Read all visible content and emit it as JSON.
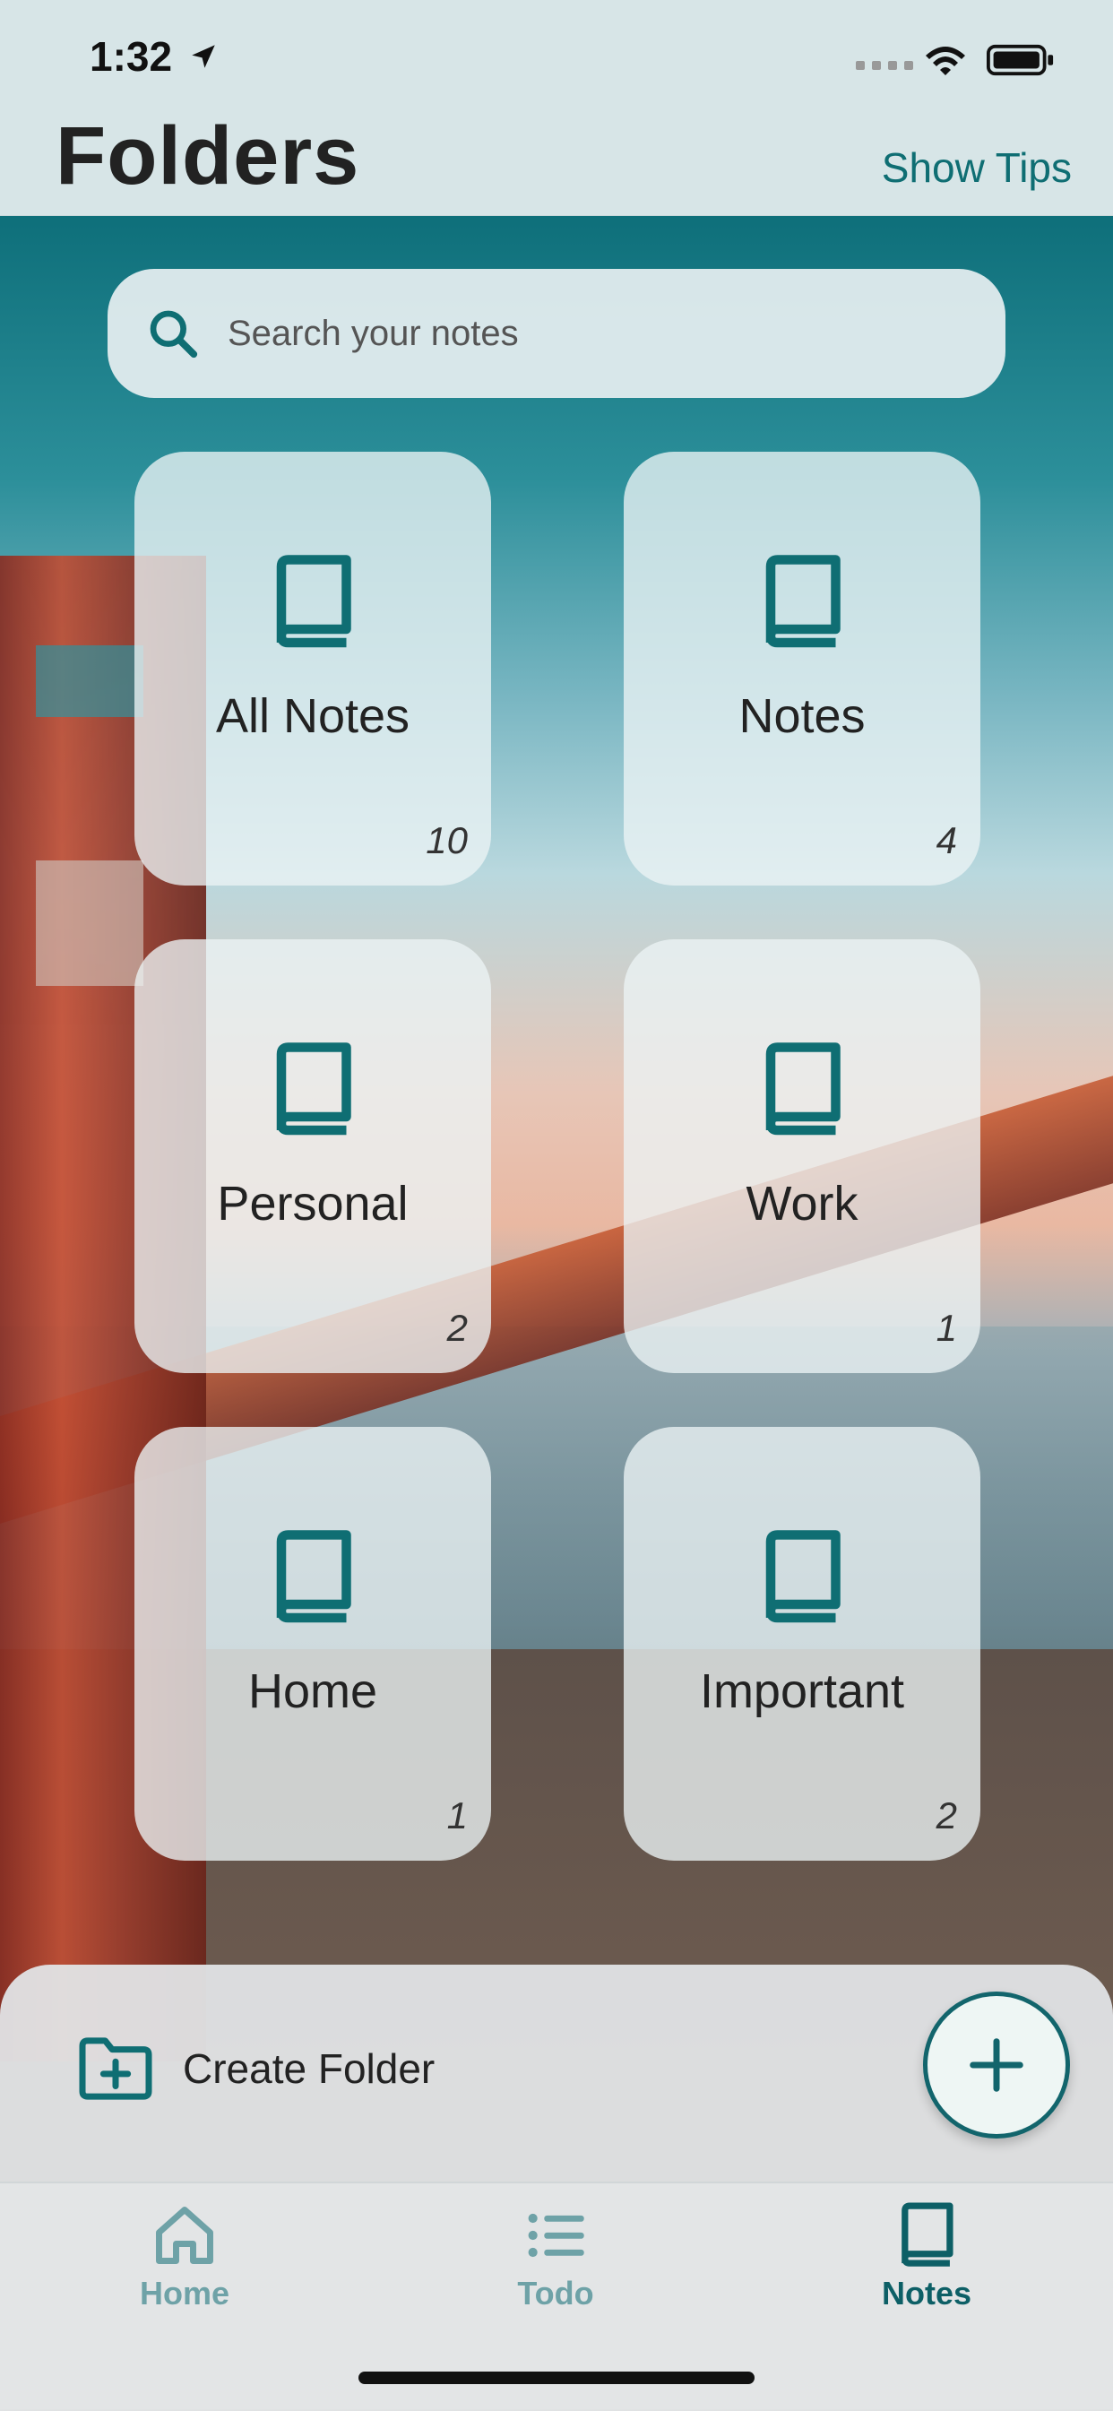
{
  "status_bar": {
    "time": "1:32"
  },
  "header": {
    "title": "Folders",
    "tips_label": "Show Tips"
  },
  "search": {
    "placeholder": "Search your notes"
  },
  "folders": [
    {
      "name": "All Notes",
      "count": "10"
    },
    {
      "name": "Notes",
      "count": "4"
    },
    {
      "name": "Personal",
      "count": "2"
    },
    {
      "name": "Work",
      "count": "1"
    },
    {
      "name": "Home",
      "count": "1"
    },
    {
      "name": "Important",
      "count": "2"
    }
  ],
  "actions": {
    "create_folder_label": "Create Folder"
  },
  "tab_bar": {
    "items": [
      {
        "label": "Home",
        "icon": "home-icon",
        "selected": false
      },
      {
        "label": "Todo",
        "icon": "list-icon",
        "selected": false
      },
      {
        "label": "Notes",
        "icon": "book-icon",
        "selected": true
      }
    ]
  },
  "colors": {
    "accent": "#0f6e73",
    "inactive_tab": "#6ea2a7"
  }
}
